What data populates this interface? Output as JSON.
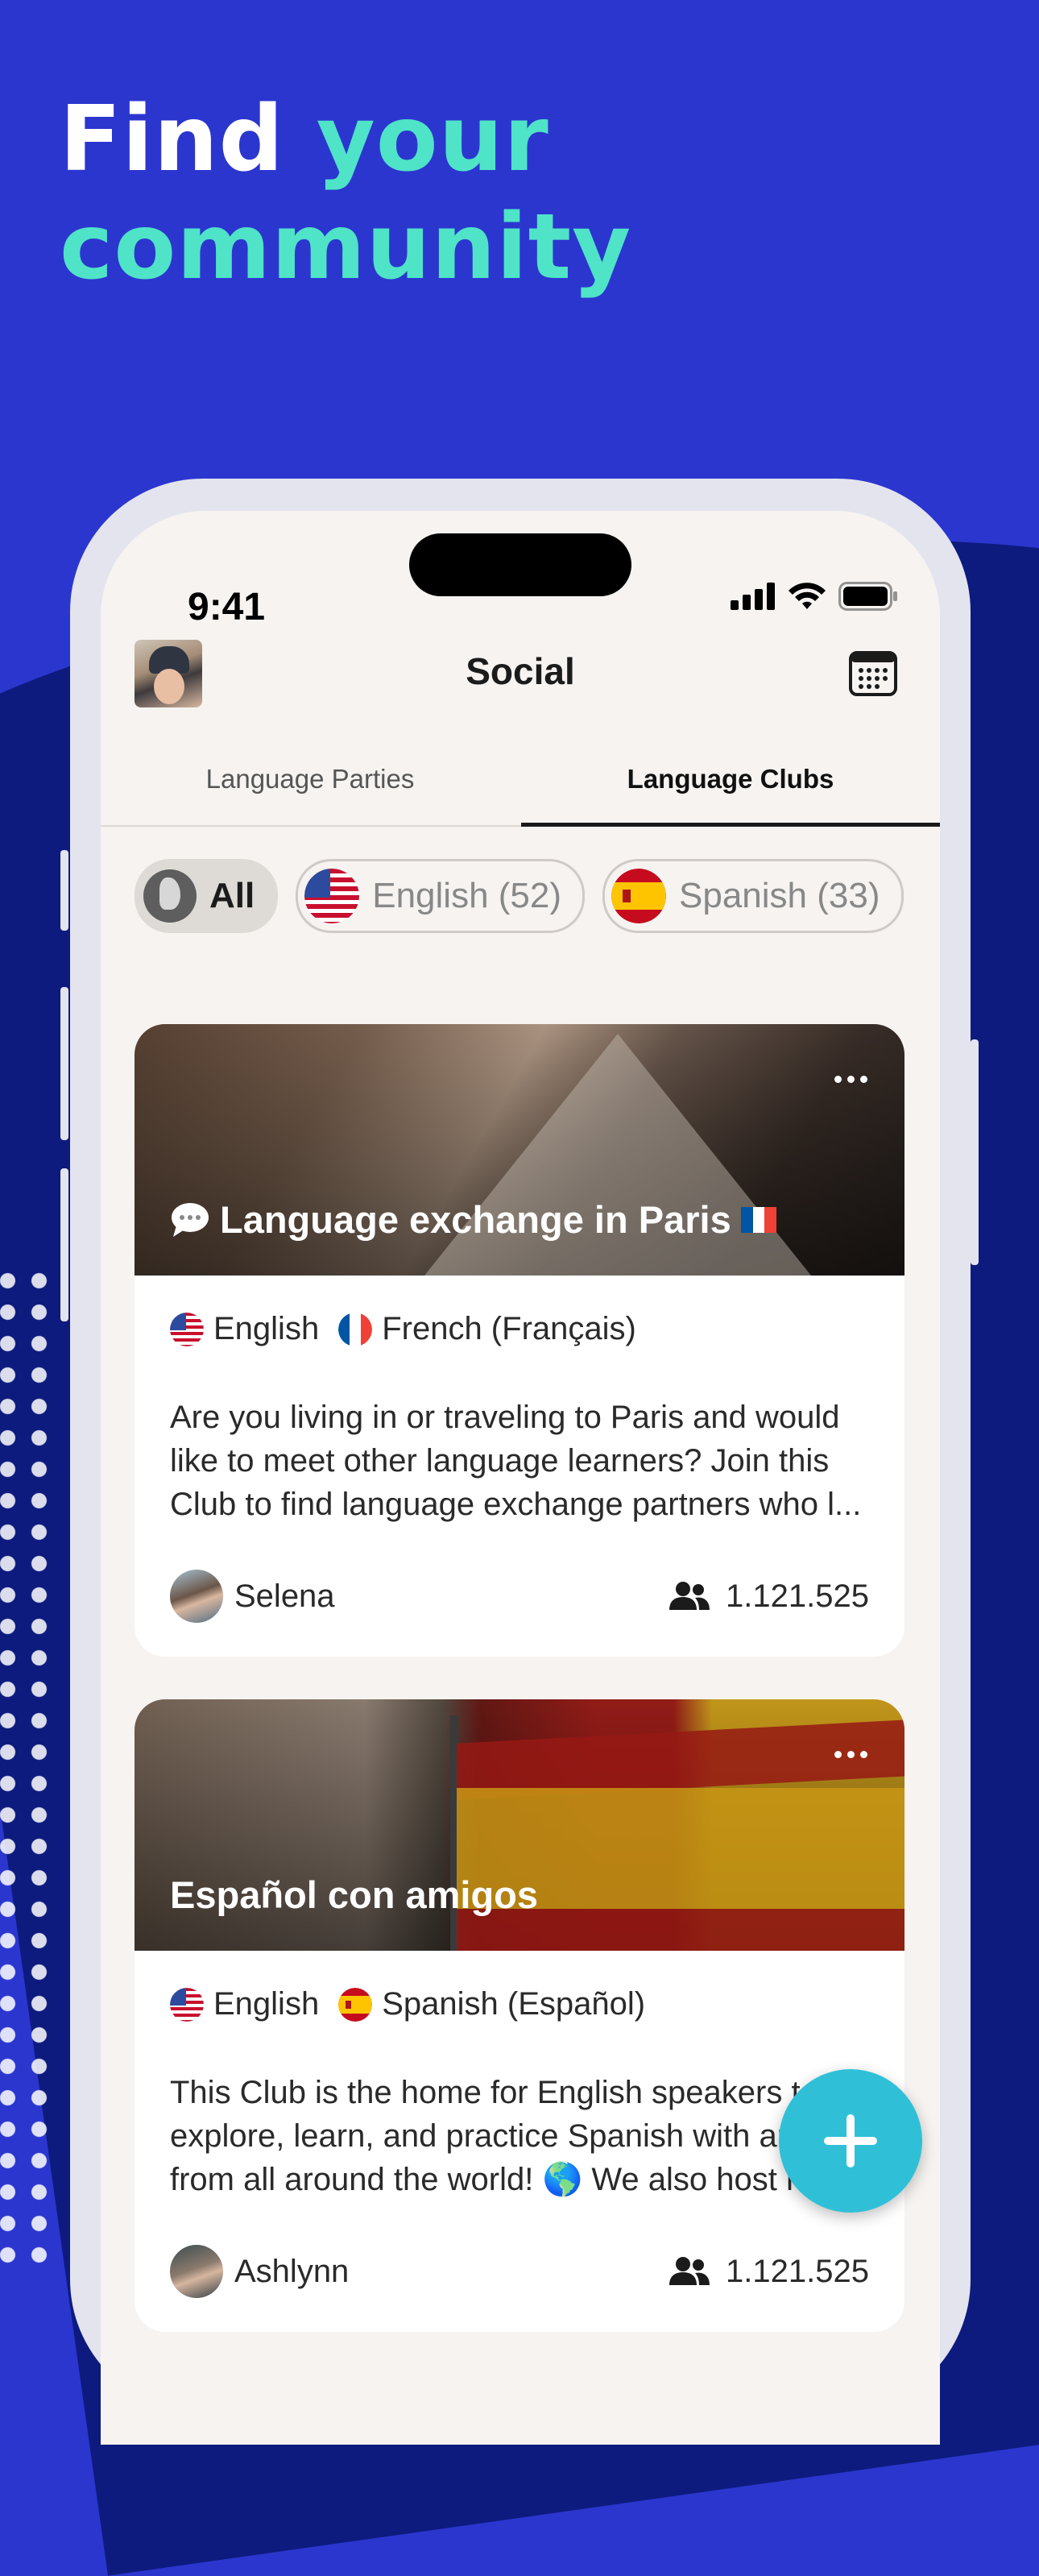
{
  "headline": {
    "line1_white": "Find ",
    "line1_accent": "your",
    "line2_accent": "community"
  },
  "status_bar": {
    "time": "9:41"
  },
  "header": {
    "title": "Social"
  },
  "tabs": [
    {
      "label": "Language Parties",
      "active": false
    },
    {
      "label": "Language Clubs",
      "active": true
    }
  ],
  "filters": [
    {
      "label": "All",
      "icon": "globe-icon",
      "active": true
    },
    {
      "label": "English (52)",
      "icon": "us-flag-icon",
      "active": false
    },
    {
      "label": "Spanish (33)",
      "icon": "spain-flag-icon",
      "active": false
    }
  ],
  "clubs": [
    {
      "title": "Language exchange in Paris",
      "title_prefix_icon": "speech-bubble-icon",
      "title_suffix_icon": "france-flag-icon",
      "languages": [
        "English",
        "French (Français)"
      ],
      "description": "Are you living in or traveling to Paris and would like to meet other language learners? Join this Club to find language exchange partners who l...",
      "owner": "Selena",
      "members": "1.121.525"
    },
    {
      "title": "Español con amigos",
      "languages": [
        "English",
        "Spanish (Español)"
      ],
      "description": "This Club is the home for English speakers to explore, learn, and practice Spanish with ami from all around the world! 🌎 We also host r",
      "owner": "Ashlynn",
      "members": "1.121.525"
    }
  ],
  "colors": {
    "background": "#2b36cf",
    "accent": "#4fe3c7",
    "fab": "#2fc0d8"
  }
}
